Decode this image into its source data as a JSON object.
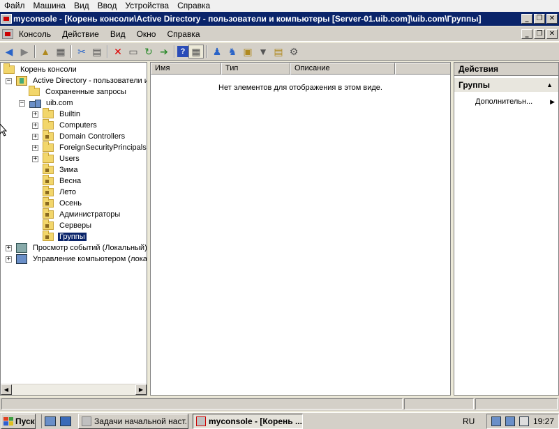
{
  "host_menu": [
    "Файл",
    "Машина",
    "Вид",
    "Ввод",
    "Устройства",
    "Справка"
  ],
  "window_title": "myconsole - [Корень консоли\\Active Directory - пользователи и компьютеры [Server-01.uib.com]\\uib.com\\Группы]",
  "window_buttons": {
    "minimize": "_",
    "restore": "❐",
    "close": "✕"
  },
  "menubar": [
    "Консоль",
    "Действие",
    "Вид",
    "Окно",
    "Справка"
  ],
  "toolbar_icons": [
    "back-icon",
    "forward-icon",
    "up-icon",
    "show-tree-icon",
    "cut-icon",
    "paste-icon",
    "delete-icon",
    "properties-icon",
    "refresh-icon",
    "export-icon",
    "help-icon",
    "show-action-pane-icon",
    "new-user-icon",
    "new-group-icon",
    "new-ou-icon",
    "filter-icon",
    "find-icon",
    "add-to-group-icon"
  ],
  "tree": {
    "root": "Корень консоли",
    "aduc": "Active Directory - пользователи и",
    "saved_queries": "Сохраненные запросы",
    "domain": "uib.com",
    "children": [
      {
        "label": "Builtin",
        "expandable": true,
        "ou": false
      },
      {
        "label": "Computers",
        "expandable": true,
        "ou": false
      },
      {
        "label": "Domain Controllers",
        "expandable": true,
        "ou": true
      },
      {
        "label": "ForeignSecurityPrincipals",
        "expandable": true,
        "ou": false
      },
      {
        "label": "Users",
        "expandable": true,
        "ou": false
      },
      {
        "label": "Зима",
        "expandable": false,
        "ou": true
      },
      {
        "label": "Весна",
        "expandable": false,
        "ou": true
      },
      {
        "label": "Лето",
        "expandable": false,
        "ou": true
      },
      {
        "label": "Осень",
        "expandable": false,
        "ou": true
      },
      {
        "label": "Администраторы",
        "expandable": false,
        "ou": true
      },
      {
        "label": "Серверы",
        "expandable": false,
        "ou": true
      },
      {
        "label": "Группы",
        "expandable": false,
        "ou": true,
        "selected": true
      }
    ],
    "event_viewer": "Просмотр событий (Локальный)",
    "computer_mgmt": "Управление компьютером (лока"
  },
  "list": {
    "columns": [
      "Имя",
      "Тип",
      "Описание"
    ],
    "empty_message": "Нет элементов для отображения в этом виде."
  },
  "actions": {
    "header": "Действия",
    "group": "Группы",
    "more": "Дополнительн..."
  },
  "taskbar": {
    "start": "Пуск",
    "tasks": [
      {
        "label": "Задачи начальной наст...",
        "active": false
      },
      {
        "label": "myconsole - [Корень ...",
        "active": true
      }
    ],
    "lang": "RU",
    "clock": "19:27"
  }
}
